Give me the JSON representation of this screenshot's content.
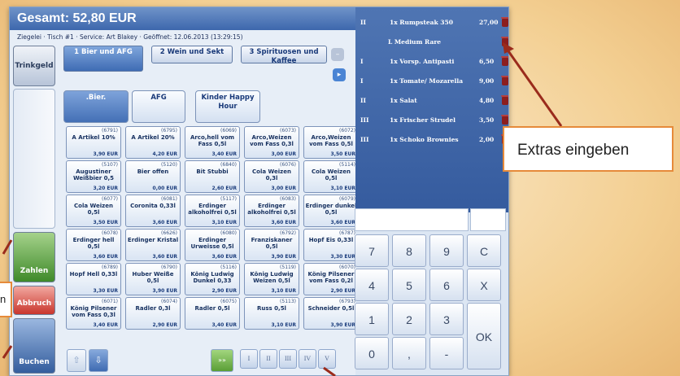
{
  "header": {
    "total": "Gesamt: 52,80 EUR"
  },
  "info": "Ziegelei · Tisch #1 · Service: Art Blakey · Geöffnet: 12.06.2013 (13:29:15)",
  "side": {
    "trinkgeld": "Trinkgeld",
    "zahlen": "Zahlen",
    "abbruch": "Abbruch",
    "buchen": "Buchen"
  },
  "tabs": [
    "1 Bier und AFG",
    "2 Wein und Sekt",
    "3 Spirituosen und Kaffee"
  ],
  "subtabs": [
    ".Bier.",
    "AFG",
    "Kinder Happy Hour"
  ],
  "products": [
    {
      "id": "(6791)",
      "name": "A Artikel 10%",
      "price": "3,90 EUR"
    },
    {
      "id": "(6795)",
      "name": "A Artikel 20%",
      "price": "4,20 EUR"
    },
    {
      "id": "(6069)",
      "name": "Arco,hell vom Fass 0,5l",
      "price": "3,40 EUR"
    },
    {
      "id": "(6073)",
      "name": "Arco,Weizen vom Fass 0,3l",
      "price": "3,00 EUR"
    },
    {
      "id": "(6072)",
      "name": "Arco,Weizen vom Fass 0,5l",
      "price": "3,50 EUR"
    },
    {
      "id": "(5107)",
      "name": "Augustiner Weißbier 0,5",
      "price": "3,20 EUR"
    },
    {
      "id": "(5120)",
      "name": "Bier offen",
      "price": "0,00 EUR"
    },
    {
      "id": "(6840)",
      "name": "Bit Stubbi",
      "price": "2,60 EUR"
    },
    {
      "id": "(6076)",
      "name": "Cola Weizen 0,3l",
      "price": "3,00 EUR"
    },
    {
      "id": "(5114)",
      "name": "Cola Weizen 0,5l",
      "price": "3,10 EUR"
    },
    {
      "id": "(6077)",
      "name": "Cola Weizen 0,5l",
      "price": "3,50 EUR"
    },
    {
      "id": "(6081)",
      "name": "Coronita 0,33l",
      "price": "3,60 EUR"
    },
    {
      "id": "(5117)",
      "name": "Erdinger alkoholfrei 0,5l",
      "price": "3,10 EUR"
    },
    {
      "id": "(6083)",
      "name": "Erdinger alkoholfrei 0,5l",
      "price": "3,60 EUR"
    },
    {
      "id": "(6079)",
      "name": "Erdinger dunkel 0,5l",
      "price": "3,60 EUR"
    },
    {
      "id": "(6078)",
      "name": "Erdinger hell 0,5l",
      "price": "3,60 EUR"
    },
    {
      "id": "(6626)",
      "name": "Erdinger Kristal",
      "price": "3,60 EUR"
    },
    {
      "id": "(6080)",
      "name": "Erdinger Urweisse 0,5l",
      "price": "3,60 EUR"
    },
    {
      "id": "(6792)",
      "name": "Franziskaner 0,5l",
      "price": "3,90 EUR"
    },
    {
      "id": "(6787)",
      "name": "Hopf Eis 0,33l",
      "price": "3,30 EUR"
    },
    {
      "id": "(6789)",
      "name": "Hopf Hell 0,33l",
      "price": "3,30 EUR"
    },
    {
      "id": "(6790)",
      "name": "Huber Weiße 0,5l",
      "price": "3,90 EUR"
    },
    {
      "id": "(5116)",
      "name": "König Ludwig Dunkel 0,33",
      "price": "2,90 EUR"
    },
    {
      "id": "(5119)",
      "name": "König Ludwig Weizen 0,5l",
      "price": "3,10 EUR"
    },
    {
      "id": "(6070)",
      "name": "König Pilsener vom Fass 0,2l",
      "price": "2,90 EUR"
    },
    {
      "id": "(6071)",
      "name": "König Pilsener vom Fass 0,3l",
      "price": "3,40 EUR"
    },
    {
      "id": "(6074)",
      "name": "Radler 0,3l",
      "price": "2,90 EUR"
    },
    {
      "id": "(6075)",
      "name": "Radler 0,5l",
      "price": "3,40 EUR"
    },
    {
      "id": "(5113)",
      "name": "Russ 0,5l",
      "price": "3,10 EUR"
    },
    {
      "id": "(6793)",
      "name": "Schneider 0,5l",
      "price": "3,90 EUR"
    }
  ],
  "nav": {
    "fast_forward": "»»",
    "courses": [
      "I",
      "II",
      "III",
      "IV",
      "V"
    ]
  },
  "orders": [
    {
      "course": "II",
      "text": "1x Rumpsteak 350",
      "price": "27,00"
    },
    {
      "course": "",
      "text": "L Medium Rare",
      "price": ""
    },
    {
      "course": "I",
      "text": "1x Vorsp. Antipasti",
      "price": "6,50"
    },
    {
      "course": "I",
      "text": "1x Tomate/ Mozarella",
      "price": "9,00"
    },
    {
      "course": "II",
      "text": "1x Salat",
      "price": "4,80"
    },
    {
      "course": "III",
      "text": "1x Frischer Strudel",
      "price": "3,50"
    },
    {
      "course": "III",
      "text": "1x Schoko Brownies",
      "price": "2,00"
    }
  ],
  "keypad": [
    "7",
    "8",
    "9",
    "C",
    "4",
    "5",
    "6",
    "X",
    "1",
    "2",
    "3",
    "OK",
    "0",
    ",",
    "-"
  ],
  "callout": "Extras eingeben",
  "colors": {
    "accent": "#3d67ad",
    "zahlen": "#3f8a2a",
    "abbruch": "#c9362d",
    "callout_border": "#e68a3a"
  }
}
